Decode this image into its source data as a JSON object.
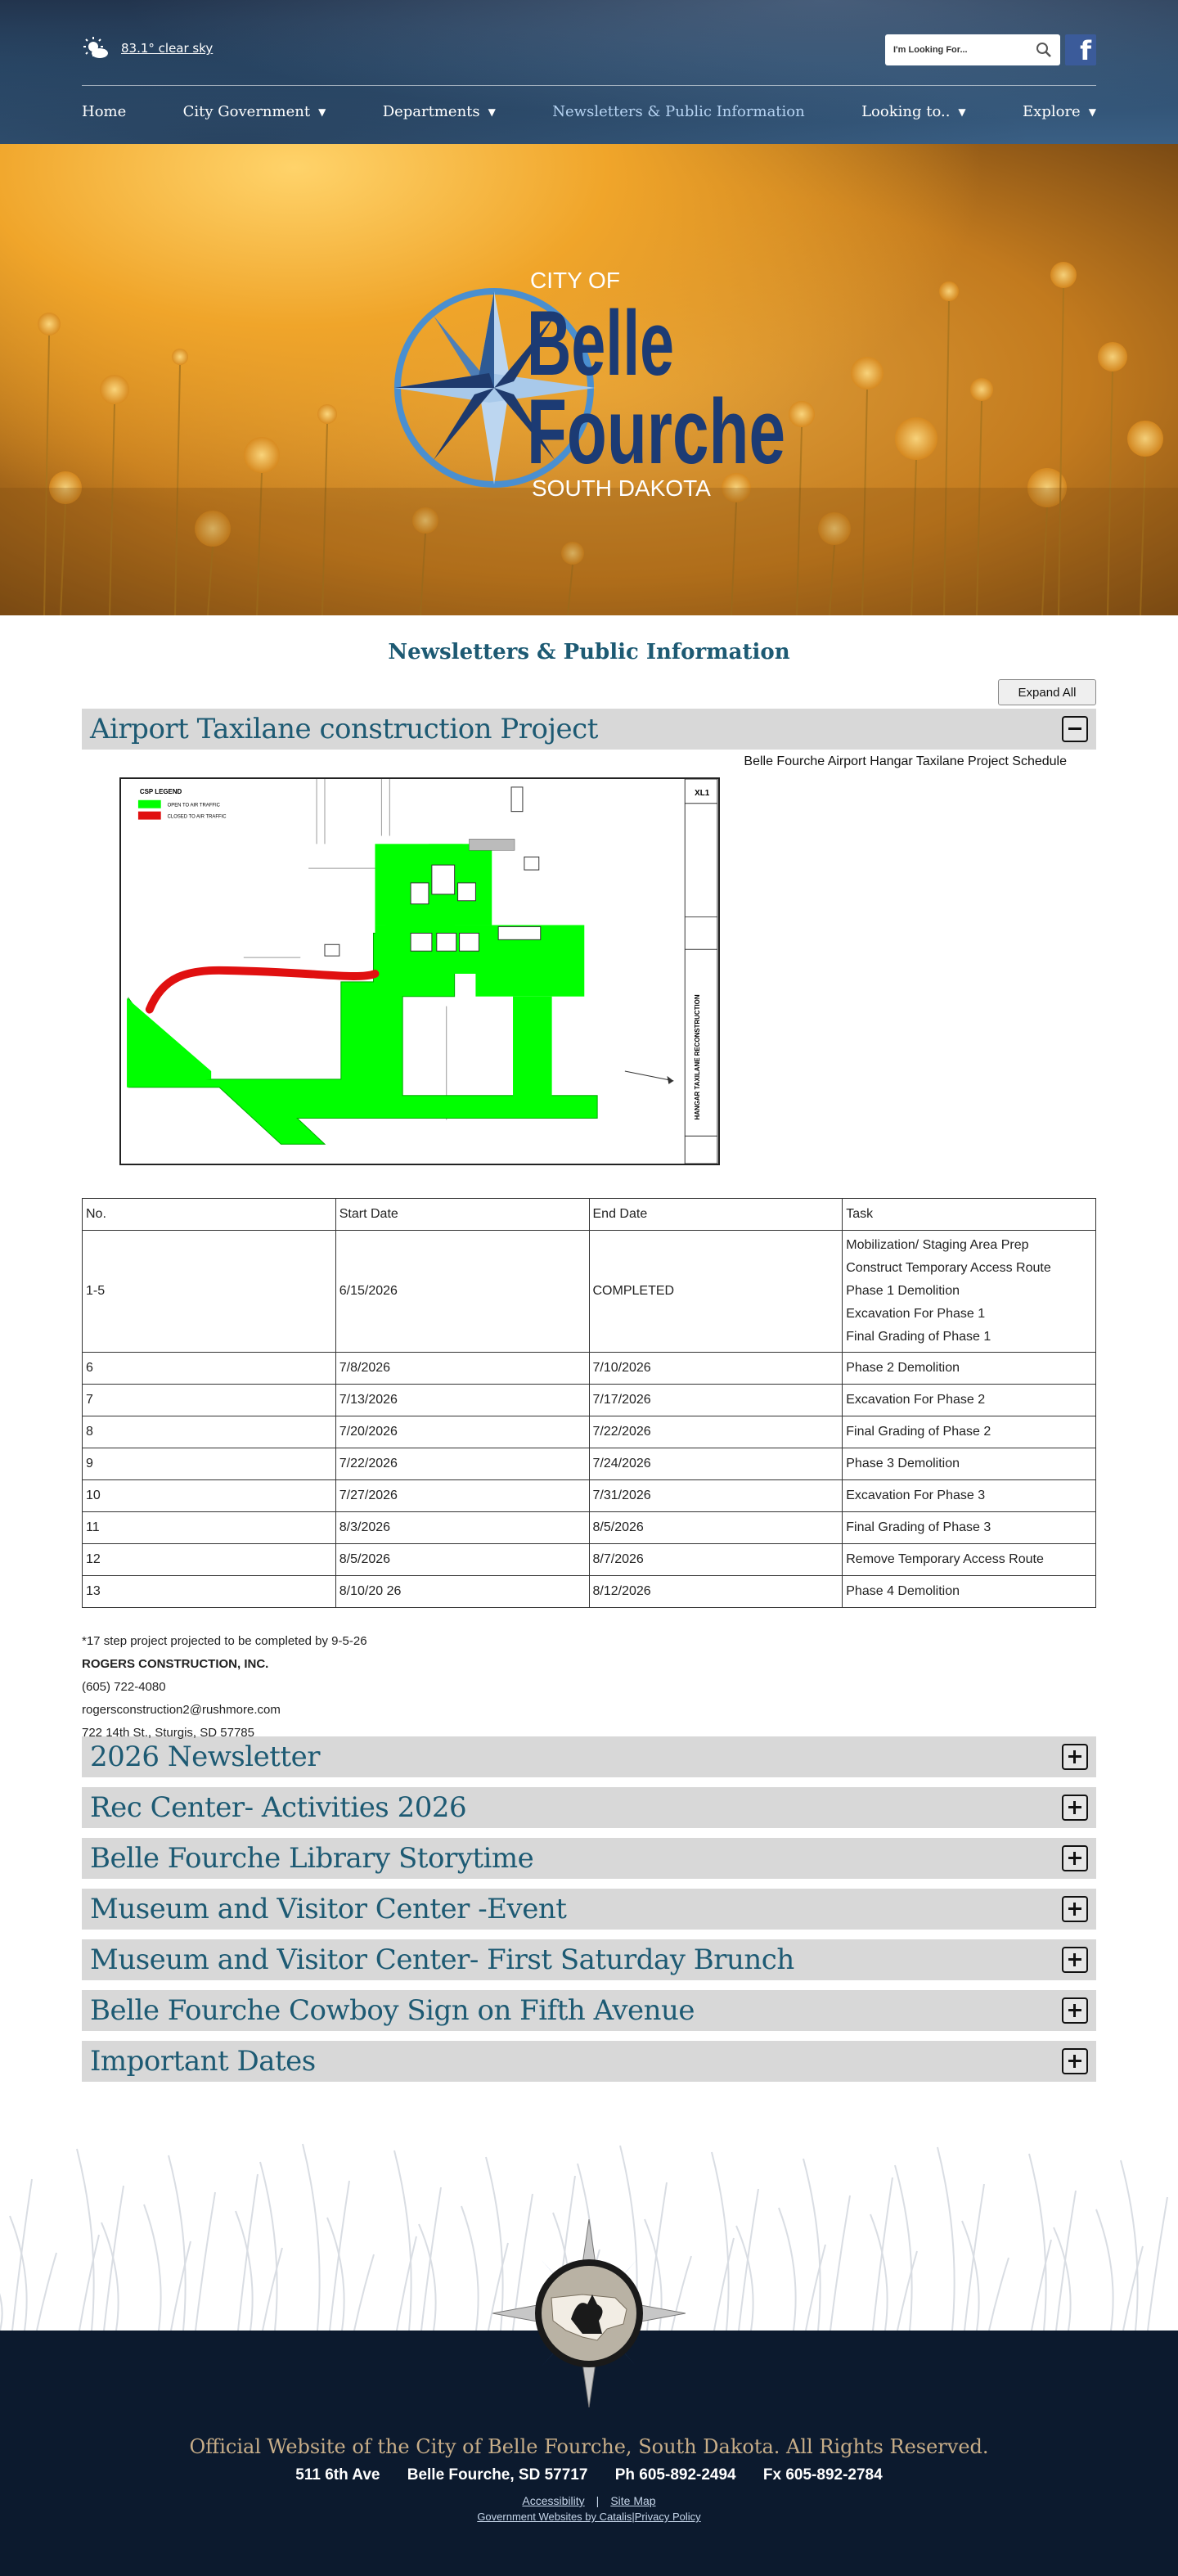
{
  "header": {
    "weather_text": "83.1° clear sky",
    "search_placeholder": "I'm Looking For...",
    "facebook_glyph": "f"
  },
  "nav": [
    {
      "label": "Home",
      "has_caret": false
    },
    {
      "label": "City Government",
      "has_caret": true
    },
    {
      "label": "Departments",
      "has_caret": true
    },
    {
      "label": "Newsletters & Public Information",
      "has_caret": false,
      "active": true
    },
    {
      "label": "Looking to..",
      "has_caret": true
    },
    {
      "label": "Explore",
      "has_caret": true
    }
  ],
  "caret": "▼",
  "logo": {
    "top": "CITY OF",
    "line1": "Belle",
    "line2": "Fourche",
    "bottom": "SOUTH DAKOTA"
  },
  "page_title": "Newsletters & Public Information",
  "expand_all": "Expand All",
  "airport": {
    "title": "Airport Taxilane construction Project",
    "schedule_title": "Belle Fourche Airport Hangar Taxilane Project Schedule",
    "map": {
      "legend_title": "CSP LEGEND",
      "legend_open": "OPEN TO AIR TRAFFIC",
      "legend_closed": "CLOSED TO AIR TRAFFIC",
      "sheet_title": "HANGAR TAXILANE RECONSTRUCTION",
      "sheet_id": "XL1"
    },
    "table": {
      "headers": [
        "No.",
        "Start Date",
        "End Date",
        "Task"
      ],
      "rows": [
        {
          "no": "1-5",
          "start": "6/15/2026",
          "end": "COMPLETED",
          "tasks": [
            "Mobilization/ Staging Area Prep",
            "Construct Temporary Access Route",
            "Phase 1 Demolition",
            "Excavation For Phase 1",
            "Final Grading of Phase 1"
          ]
        },
        {
          "no": "6",
          "start": "7/8/2026",
          "end": "7/10/2026",
          "tasks": [
            "Phase 2 Demolition"
          ]
        },
        {
          "no": "7",
          "start": "7/13/2026",
          "end": "7/17/2026",
          "tasks": [
            "Excavation For Phase 2"
          ]
        },
        {
          "no": "8",
          "start": "7/20/2026",
          "end": "7/22/2026",
          "tasks": [
            "Final Grading of Phase 2"
          ]
        },
        {
          "no": "9",
          "start": "7/22/2026",
          "end": "7/24/2026",
          "tasks": [
            "Phase 3 Demolition"
          ]
        },
        {
          "no": "10",
          "start": "7/27/2026",
          "end": "7/31/2026",
          "tasks": [
            "Excavation For Phase 3"
          ]
        },
        {
          "no": "11",
          "start": "8/3/2026",
          "end": "8/5/2026",
          "tasks": [
            "Final Grading of Phase 3"
          ]
        },
        {
          "no": "12",
          "start": "8/5/2026",
          "end": "8/7/2026",
          "tasks": [
            "Remove Temporary Access Route"
          ]
        },
        {
          "no": "13",
          "start": "8/10/20    26",
          "end": "8/12/2026",
          "tasks": [
            "Phase 4 Demolition"
          ]
        }
      ]
    },
    "note": "*17 step project projected to be completed by 9-5-26",
    "company": "ROGERS CONSTRUCTION, INC.",
    "phone": "(605) 722-4080",
    "email": "rogersconstruction2@rushmore.com",
    "address": "722 14th St., Sturgis, SD 57785"
  },
  "sections": [
    "2026 Newsletter",
    "Rec Center- Activities 2026",
    "Belle Fourche Library Storytime",
    "Museum and Visitor Center -Event",
    "Museum and Visitor Center- First Saturday Brunch",
    "Belle Fourche Cowboy Sign on Fifth Avenue",
    "Important Dates"
  ],
  "footer": {
    "rights": "Official Website of the City of Belle Fourche, South Dakota. All Rights Reserved.",
    "address": "511 6th Ave",
    "city": "Belle Fourche, SD 57717",
    "phone": "Ph 605-892-2494",
    "fax": "Fx 605-892-2784",
    "accessibility": "Accessibility",
    "separator": "|",
    "sitemap": "Site Map",
    "gov_websites": "Government Websites by Catalis",
    "privacy": "Privacy Policy"
  },
  "colors": {
    "accent": "#1d5a73",
    "header_bg": "#2b4a6a",
    "footer_bg": "#0c1a2e",
    "map_green": "#00ff00",
    "map_red": "#e01010"
  }
}
